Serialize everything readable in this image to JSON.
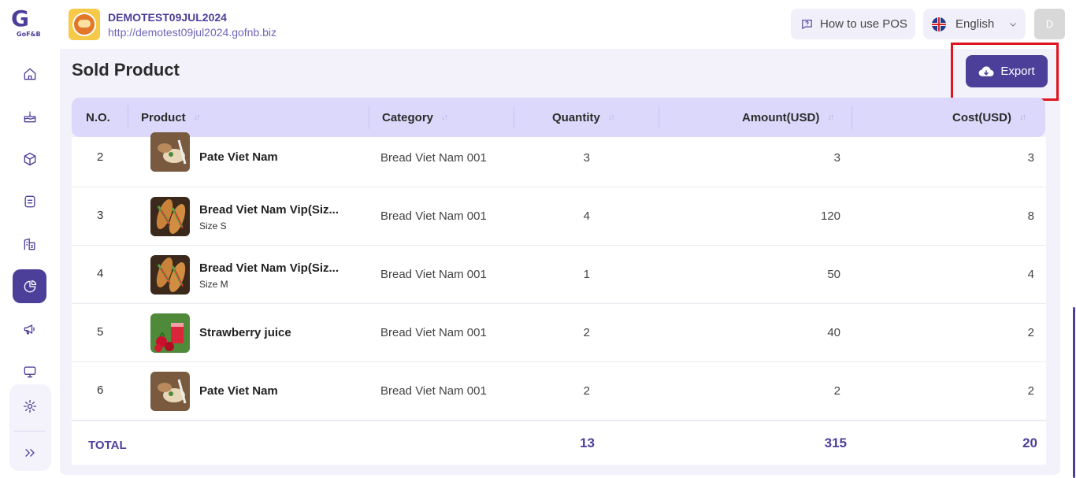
{
  "app": {
    "logo_text": "G",
    "logo_label": "GoF&B"
  },
  "header": {
    "store_name": "DEMOTEST09JUL2024",
    "store_url": "http://demotest09jul2024.gofnb.biz",
    "how_to_label": "How to use POS",
    "language": "English",
    "avatar_initial": "D"
  },
  "sidebar": {
    "items": [
      {
        "name": "home",
        "icon": "home-icon"
      },
      {
        "name": "store",
        "icon": "cake-icon"
      },
      {
        "name": "product",
        "icon": "box-icon"
      },
      {
        "name": "orders",
        "icon": "document-icon"
      },
      {
        "name": "branch",
        "icon": "building-icon"
      },
      {
        "name": "report",
        "icon": "pie-chart-icon",
        "active": true
      },
      {
        "name": "marketing",
        "icon": "megaphone-icon"
      },
      {
        "name": "pos",
        "icon": "monitor-icon"
      },
      {
        "name": "settings",
        "icon": "gear-icon"
      },
      {
        "name": "expand",
        "icon": "chevrons-right-icon"
      }
    ]
  },
  "page": {
    "title": "Sold Product",
    "export_label": "Export"
  },
  "table": {
    "columns": [
      "N.O.",
      "Product",
      "Category",
      "Quantity",
      "Amount(USD)",
      "Cost(USD)"
    ],
    "rows": [
      {
        "no": "2",
        "product": "Pate Viet Nam",
        "size": "",
        "category": "Bread Viet Nam 001",
        "quantity": "3",
        "amount": "3",
        "cost": "3",
        "image": "pate"
      },
      {
        "no": "3",
        "product": "Bread Viet Nam Vip(Siz...",
        "size": "Size S",
        "category": "Bread Viet Nam 001",
        "quantity": "4",
        "amount": "120",
        "cost": "8",
        "image": "bread"
      },
      {
        "no": "4",
        "product": "Bread Viet Nam Vip(Siz...",
        "size": "Size M",
        "category": "Bread Viet Nam 001",
        "quantity": "1",
        "amount": "50",
        "cost": "4",
        "image": "bread"
      },
      {
        "no": "5",
        "product": "Strawberry juice",
        "size": "",
        "category": "Bread Viet Nam 001",
        "quantity": "2",
        "amount": "40",
        "cost": "2",
        "image": "juice"
      },
      {
        "no": "6",
        "product": "Pate Viet Nam",
        "size": "",
        "category": "Bread Viet Nam 001",
        "quantity": "2",
        "amount": "2",
        "cost": "2",
        "image": "pate"
      }
    ],
    "total": {
      "label": "TOTAL",
      "quantity": "13",
      "amount": "315",
      "cost": "20"
    }
  },
  "colors": {
    "primary": "#4c3f99",
    "header_bg": "#dcd8fb",
    "content_bg": "#f3f2fb",
    "highlight": "#e0141e"
  }
}
